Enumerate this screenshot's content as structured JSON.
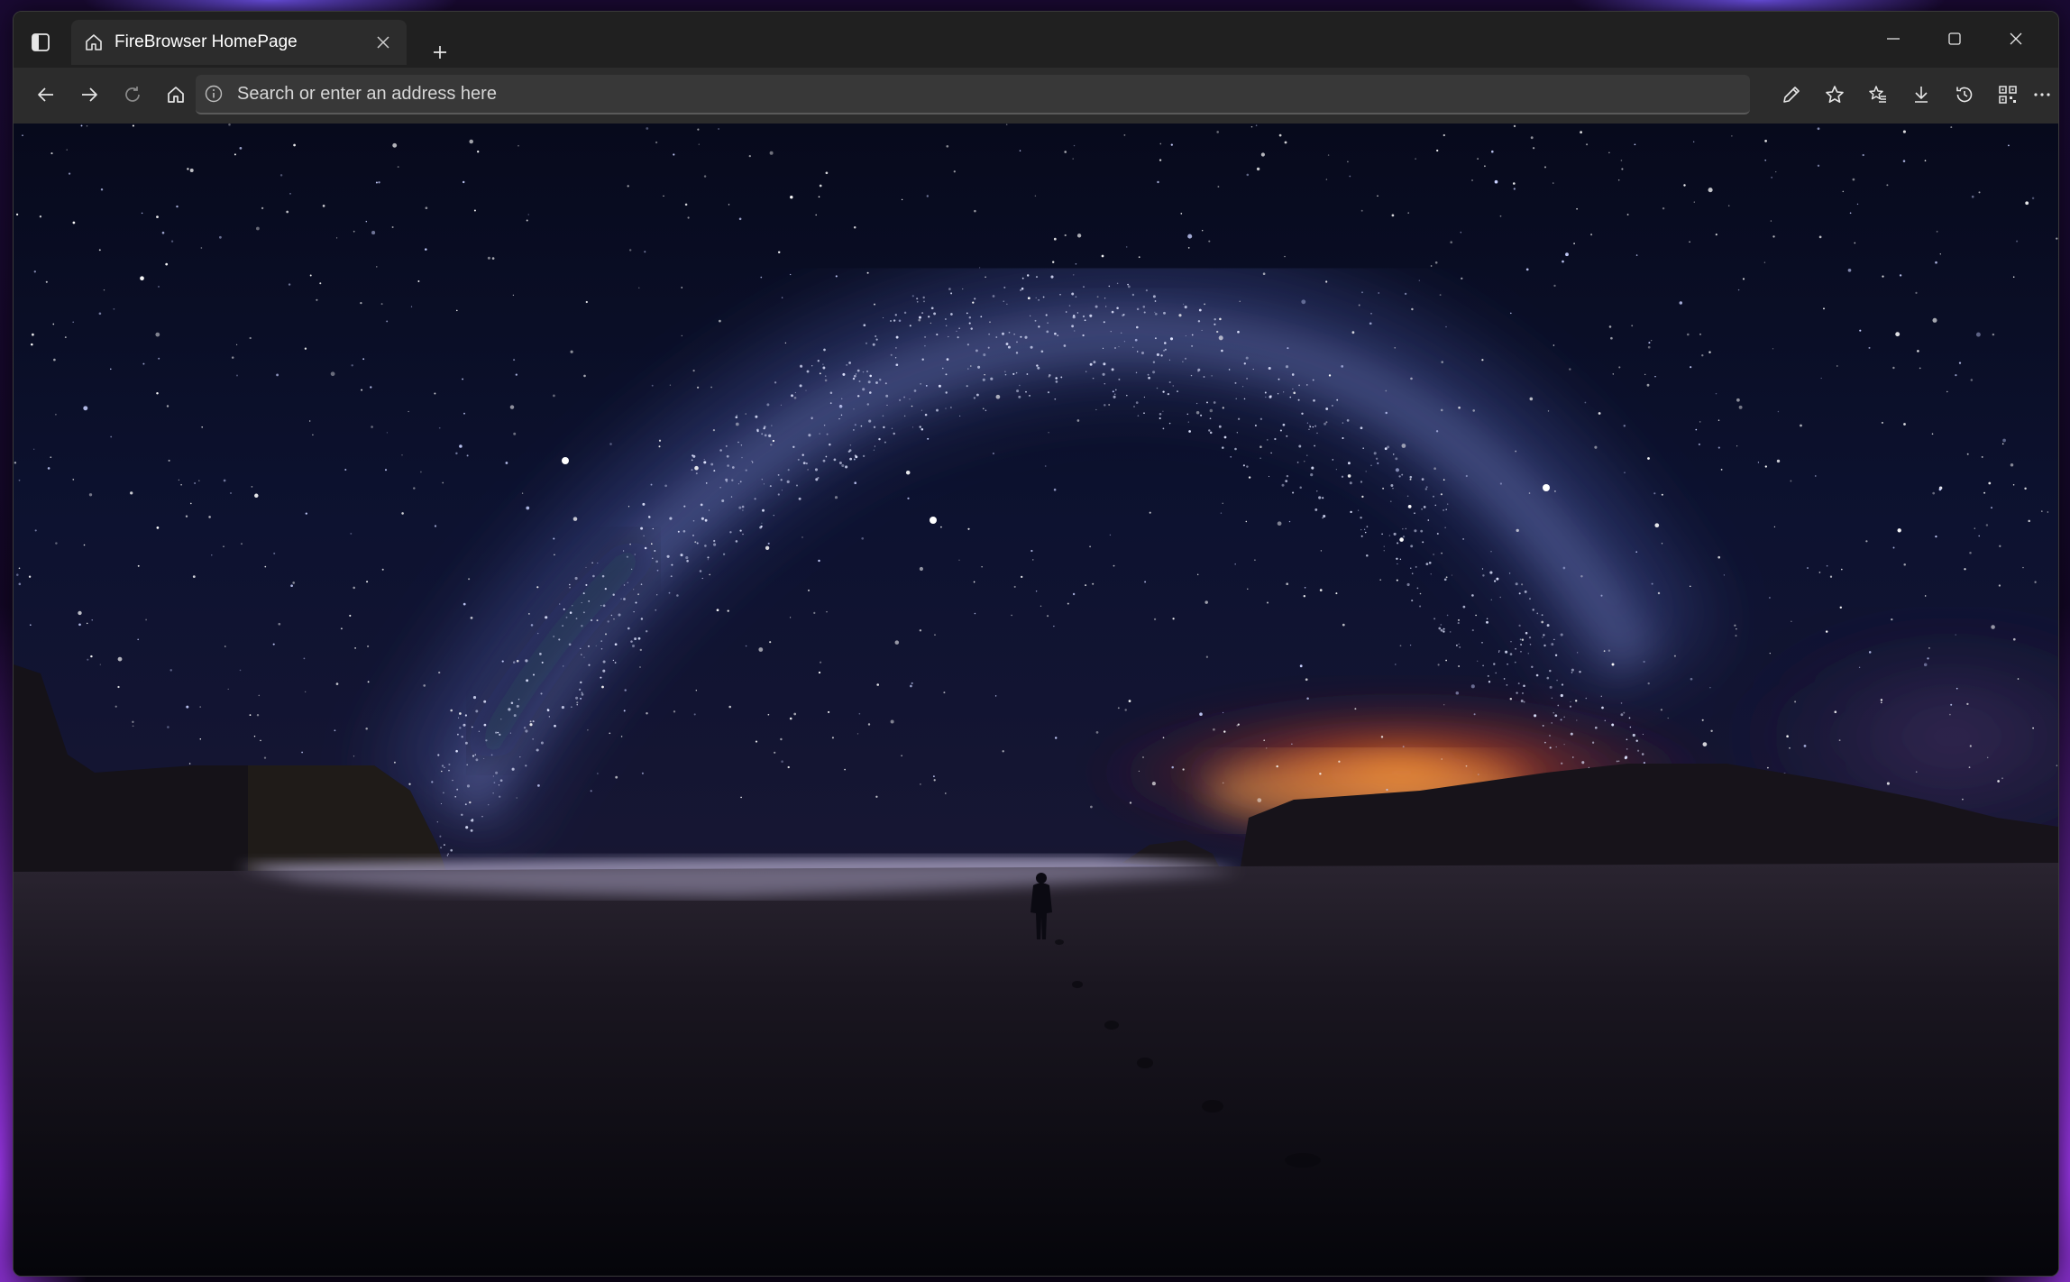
{
  "window": {
    "tab_title": "FireBrowser HomePage",
    "new_tab_symbol": "+"
  },
  "toolbar": {
    "address_placeholder": "Search or enter an address here"
  },
  "icons": {
    "sidebar_toggle": "sidebar-toggle-icon",
    "tab_favicon": "home-icon",
    "tab_close": "close-icon",
    "minimize": "minimize-icon",
    "maximize": "maximize-icon",
    "close_window": "close-icon",
    "back": "arrow-left-icon",
    "forward": "arrow-right-icon",
    "refresh": "refresh-icon",
    "home": "home-icon",
    "site_info": "info-icon",
    "pen": "pen-icon",
    "favorite": "star-icon",
    "favorites_list": "favorites-list-icon",
    "downloads": "download-icon",
    "history": "history-icon",
    "qr_code": "qr-code-icon",
    "more": "more-icon"
  },
  "colors": {
    "titlebar_bg": "#202020",
    "tab_bg": "#2c2c2c",
    "toolbar_bg": "#2c2c2c",
    "address_bg": "#383838",
    "icon_color": "#e6e6e6"
  },
  "background_image": "night sky with milky way over beach, person standing on sand"
}
